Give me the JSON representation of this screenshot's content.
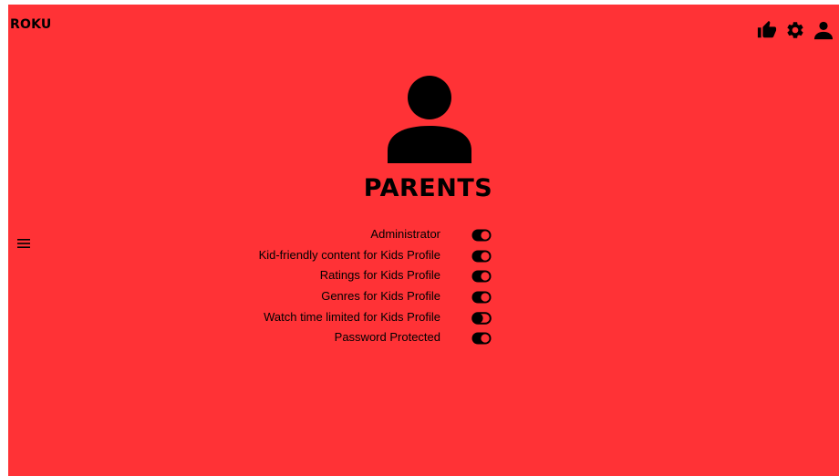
{
  "app": {
    "brand": "ROKU"
  },
  "header": {
    "icons": [
      "thumbs-up-icon",
      "gear-icon",
      "user-icon"
    ]
  },
  "profile": {
    "name": "PARENTS",
    "avatar_icon": "user-icon"
  },
  "settings": [
    {
      "label": "Administrator",
      "enabled": true
    },
    {
      "label": "Kid-friendly content for Kids Profile",
      "enabled": true
    },
    {
      "label": "Ratings for Kids Profile",
      "enabled": true
    },
    {
      "label": "Genres for Kids Profile",
      "enabled": true
    },
    {
      "label": "Watch time limited for Kids Profile",
      "enabled": false
    },
    {
      "label": "Password Protected",
      "enabled": true
    }
  ],
  "colors": {
    "background": "#ff3236",
    "foreground": "#000000"
  }
}
